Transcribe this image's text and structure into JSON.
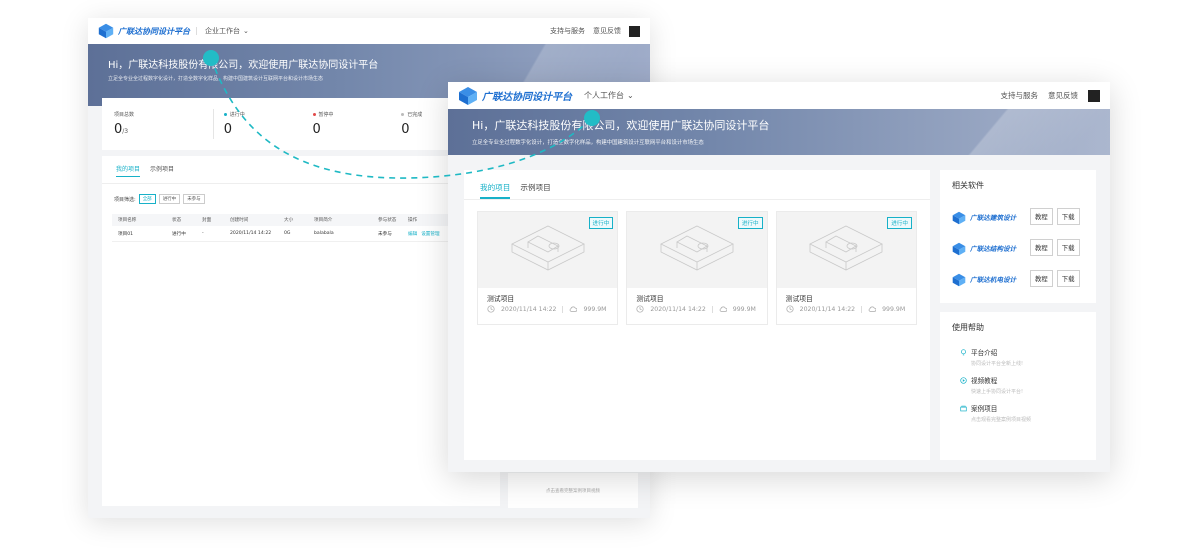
{
  "brand": "广联达协同设计平台",
  "colors": {
    "accent": "#17b1c8",
    "brand": "#1e6fd0",
    "banner": "#6f82a8"
  },
  "back_window": {
    "workspace": "企业工作台",
    "support": "支持与服务",
    "feedback": "意见反馈",
    "banner_title": "Hi，广联达科技股份有限公司，欢迎使用广联达协同设计平台",
    "banner_sub": "立足全专业全过程数字化设计，打造全数字化样品，构建中国建筑设计互联网平台和设计市场生态",
    "stats": [
      {
        "label": "项目总数",
        "value": "0",
        "suffix": "/3"
      },
      {
        "label": "进行中",
        "value": "0",
        "dot": "#17b1c8"
      },
      {
        "label": "暂停中",
        "value": "0",
        "dot": "#e24a4a"
      },
      {
        "label": "已完成",
        "value": "0",
        "dot": "#bbbbbb"
      }
    ],
    "tabs": [
      "我的项目",
      "示例项目"
    ],
    "filter_label": "项目筛选:",
    "filters": [
      "全部",
      "进行中",
      "未参与"
    ],
    "table_head": [
      "项目名称",
      "状态",
      "封面",
      "创建时间",
      "大小",
      "项目简介",
      "参与状态",
      "操作"
    ],
    "table_row": {
      "name": "项目01",
      "status": "进行中",
      "cover": "-",
      "created": "2020/11/14 14:22",
      "size": "0G",
      "intro": "balabala",
      "join": "未参与",
      "op1": "编辑",
      "op2": "设置管理"
    },
    "bottom_hint": "点击查看完整案例项目视频"
  },
  "front_window": {
    "workspace": "个人工作台",
    "support": "支持与服务",
    "feedback": "意见反馈",
    "banner_title": "Hi，广联达科技股份有限公司，欢迎使用广联达协同设计平台",
    "banner_sub": "立足全专业全过程数字化设计，打造全数字化样品，构建中国建筑设计互联网平台和设计市场生态",
    "tabs": [
      "我的项目",
      "示例项目"
    ],
    "projects": [
      {
        "name": "测试项目",
        "status": "进行中",
        "date": "2020/11/14 14:22",
        "size": "999.9M"
      },
      {
        "name": "测试项目",
        "status": "进行中",
        "date": "2020/11/14 14:22",
        "size": "999.9M"
      },
      {
        "name": "测试项目",
        "status": "进行中",
        "date": "2020/11/14 14:22",
        "size": "999.9M"
      }
    ],
    "related_title": "相关软件",
    "software": [
      {
        "name": "广联达建筑设计",
        "tutorial": "教程",
        "download": "下载"
      },
      {
        "name": "广联达结构设计",
        "tutorial": "教程",
        "download": "下载"
      },
      {
        "name": "广联达机电设计",
        "tutorial": "教程",
        "download": "下载"
      }
    ],
    "help_title": "使用帮助",
    "help": [
      {
        "title": "平台介绍",
        "sub": "协同设计平台全新上线!",
        "icon": "bulb-icon"
      },
      {
        "title": "视频教程",
        "sub": "快速上手协同设计平台!",
        "icon": "play-icon"
      },
      {
        "title": "案例项目",
        "sub": "点击观看完整案例项目视频",
        "icon": "folder-icon"
      }
    ]
  }
}
